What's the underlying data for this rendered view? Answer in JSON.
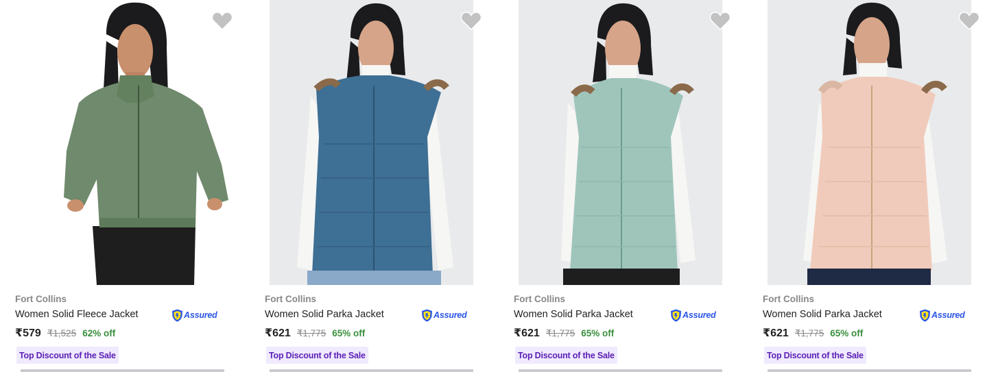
{
  "products": [
    {
      "brand": "Fort Collins",
      "title": "Women Solid Fleece Jacket",
      "assured": "Assured",
      "price": "₹579",
      "mrp": "₹1,525",
      "discount": "62% off",
      "badge": "Top Discount of the Sale",
      "jacket_color": "#6f8a6c",
      "icon": "fleece-jacket"
    },
    {
      "brand": "Fort Collins",
      "title": "Women Solid Parka Jacket",
      "assured": "Assured",
      "price": "₹621",
      "mrp": "₹1,775",
      "discount": "65% off",
      "badge": "Top Discount of the Sale",
      "jacket_color": "#3e6f94",
      "icon": "parka-vest"
    },
    {
      "brand": "Fort Collins",
      "title": "Women Solid Parka Jacket",
      "assured": "Assured",
      "price": "₹621",
      "mrp": "₹1,775",
      "discount": "65% off",
      "badge": "Top Discount of the Sale",
      "jacket_color": "#9fc5bb",
      "icon": "parka-vest"
    },
    {
      "brand": "Fort Collins",
      "title": "Women Solid Parka Jacket",
      "assured": "Assured",
      "price": "₹621",
      "mrp": "₹1,775",
      "discount": "65% off",
      "badge": "Top Discount of the Sale",
      "jacket_color": "#f0cbbb",
      "icon": "parka-vest"
    }
  ],
  "colors": {
    "discount_green": "#388e3c",
    "assured_blue": "#2a55e5",
    "badge_bg": "#f0eafe",
    "badge_text": "#5b21b6",
    "wishlist_heart": "#c2c2c2"
  }
}
